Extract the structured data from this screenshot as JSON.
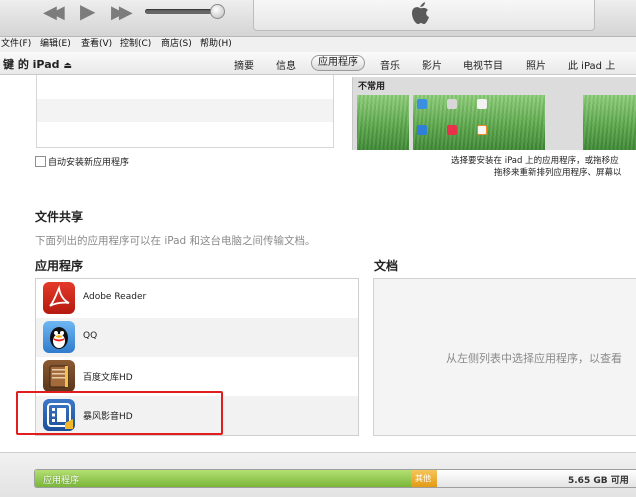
{
  "menu": {
    "file": "文件(F)",
    "edit": "编辑(E)",
    "view": "查看(V)",
    "controls": "控制(C)",
    "store": "商店(S)",
    "help": "帮助(H)"
  },
  "device": {
    "name": "键 的 iPad",
    "eject_glyph": "⏏"
  },
  "tabs": [
    {
      "label": "摘要"
    },
    {
      "label": "信息"
    },
    {
      "label": "应用程序",
      "selected": true
    },
    {
      "label": "音乐"
    },
    {
      "label": "影片"
    },
    {
      "label": "电视节目"
    },
    {
      "label": "照片"
    },
    {
      "label": "此 iPad 上"
    }
  ],
  "homescreen": {
    "page_label": "不常用"
  },
  "auto_install": {
    "label": "自动安装新应用程序",
    "checked": false
  },
  "hint": {
    "line1": "选择要安装在 iPad 上的应用程序，或拖移应",
    "line2": "拖移来重新排列应用程序、屏幕以"
  },
  "file_sharing": {
    "title": "文件共享",
    "description": "下面列出的应用程序可以在 iPad 和这台电脑之间传输文档。",
    "apps_header": "应用程序",
    "docs_header": "文档",
    "docs_hint": "从左侧列表中选择应用程序，以查看",
    "apps": [
      {
        "name": "Adobe Reader",
        "icon": "adobe-reader-icon"
      },
      {
        "name": "QQ",
        "icon": "qq-icon"
      },
      {
        "name": "百度文库HD",
        "icon": "baidu-wenku-icon"
      },
      {
        "name": "暴风影音HD",
        "icon": "baofeng-icon"
      }
    ]
  },
  "capacity": {
    "apps_label": "应用程序",
    "other_label": "其他",
    "free_label": "5.65 GB 可用",
    "apps_color": "#8cc349",
    "other_color": "#f0ad32"
  },
  "highlight_color": "#e11d1d"
}
